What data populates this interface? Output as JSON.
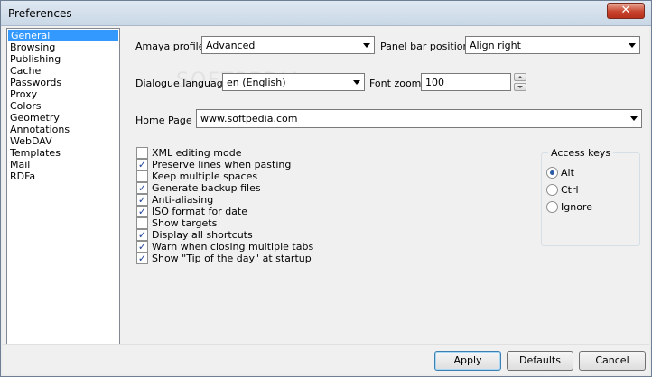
{
  "window": {
    "title": "Preferences",
    "close_label": "✕"
  },
  "categories": [
    {
      "label": "General",
      "selected": true
    },
    {
      "label": "Browsing"
    },
    {
      "label": "Publishing"
    },
    {
      "label": "Cache"
    },
    {
      "label": "Passwords"
    },
    {
      "label": "Proxy"
    },
    {
      "label": "Colors"
    },
    {
      "label": "Geometry"
    },
    {
      "label": "Annotations"
    },
    {
      "label": "WebDAV"
    },
    {
      "label": "Templates"
    },
    {
      "label": "Mail"
    },
    {
      "label": "RDFa"
    }
  ],
  "general": {
    "profile_label": "Amaya profile:",
    "profile_value": "Advanced",
    "panel_label": "Panel bar position:",
    "panel_value": "Align right",
    "dialogue_label": "Dialogue language",
    "dialogue_value": "en (English)",
    "font_zoom_label": "Font zoom",
    "font_zoom_value": "100",
    "home_label": "Home Page",
    "home_value": "www.softpedia.com",
    "watermark": "SOFTPEDIA"
  },
  "options": [
    {
      "label": "XML editing mode",
      "checked": false
    },
    {
      "label": "Preserve lines when pasting",
      "checked": true
    },
    {
      "label": "Keep multiple spaces",
      "checked": false
    },
    {
      "label": "Generate backup files",
      "checked": true
    },
    {
      "label": "Anti-aliasing",
      "checked": true
    },
    {
      "label": "ISO format for date",
      "checked": true
    },
    {
      "label": "Show targets",
      "checked": false
    },
    {
      "label": "Display all shortcuts",
      "checked": true
    },
    {
      "label": "Warn when closing multiple tabs",
      "checked": true
    },
    {
      "label": "Show \"Tip of the day\" at startup",
      "checked": true
    }
  ],
  "access_keys": {
    "title": "Access keys",
    "options": [
      {
        "label": "Alt",
        "selected": true
      },
      {
        "label": "Ctrl",
        "selected": false
      },
      {
        "label": "Ignore",
        "selected": false
      }
    ]
  },
  "buttons": {
    "apply": "Apply",
    "defaults": "Defaults",
    "cancel": "Cancel"
  },
  "check_glyph": "✓"
}
